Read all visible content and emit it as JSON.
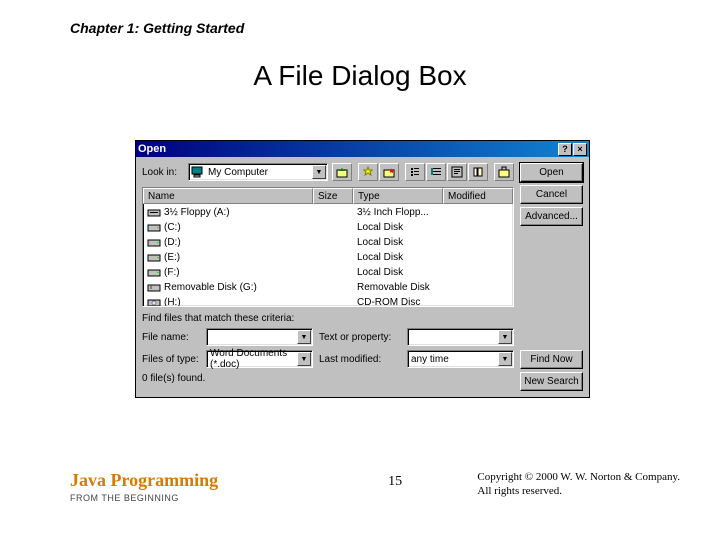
{
  "chapter_header": "Chapter 1: Getting Started",
  "slide_title": "A File Dialog Box",
  "dialog": {
    "title": "Open",
    "help_btn": "?",
    "close_btn": "×",
    "look_in_label": "Look in:",
    "look_in_value": "My Computer",
    "columns": {
      "name": "Name",
      "size": "Size",
      "type": "Type",
      "modified": "Modified"
    },
    "rows": [
      {
        "name": "3½ Floppy (A:)",
        "type": "3½ Inch Flopp..."
      },
      {
        "name": "(C:)",
        "type": "Local Disk"
      },
      {
        "name": "(D:)",
        "type": "Local Disk"
      },
      {
        "name": "(E:)",
        "type": "Local Disk"
      },
      {
        "name": "(F:)",
        "type": "Local Disk"
      },
      {
        "name": "Removable Disk (G:)",
        "type": "Removable Disk"
      },
      {
        "name": "(H:)",
        "type": "CD-ROM Disc"
      }
    ],
    "criteria_text": "Find files that match these criteria:",
    "file_name_label": "File name:",
    "file_name_value": "",
    "text_prop_label": "Text or property:",
    "text_prop_value": "",
    "files_type_label": "Files of type:",
    "files_type_value": "Word Documents (*.doc)",
    "last_mod_label": "Last modified:",
    "last_mod_value": "any time",
    "buttons": {
      "open": "Open",
      "cancel": "Cancel",
      "advanced": "Advanced...",
      "find_now": "Find Now",
      "new_search": "New Search"
    },
    "status": "0 file(s) found."
  },
  "footer": {
    "book_title": "Java Programming",
    "book_sub": "FROM THE BEGINNING",
    "page_number": "15",
    "copyright_line1": "Copyright © 2000 W. W. Norton & Company.",
    "copyright_line2": "All rights reserved."
  }
}
